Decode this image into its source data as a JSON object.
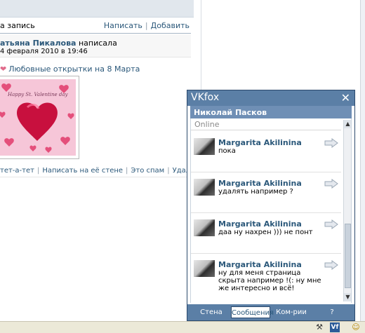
{
  "wall": {
    "label": "а запись",
    "actions": [
      "Написать",
      "Добавить"
    ],
    "author": "атьяна Пикалова",
    "verb": " написала",
    "date": "4 февраля 2010 в 19:46",
    "gift_title": "Любовные открытки на 8 Марта",
    "card_text": "Happy St. Valentine day",
    "post_actions": [
      "тет-а-тет",
      "Написать на её стене",
      "Это спам",
      "Удалить"
    ]
  },
  "vkfox": {
    "title": "VKfox",
    "close": "✕",
    "user": "Николай Пасков",
    "status": "Online",
    "messages": [
      {
        "name": "Margarita Akilinina",
        "text": "пока"
      },
      {
        "name": "Margarita Akilinina",
        "text": "удалять например ?"
      },
      {
        "name": "Margarita Akilinina",
        "text": "даа ну нахрен ))) не понт"
      },
      {
        "name": "Margarita Akilinina",
        "text": "ну для меня страница скрыта например !(: ну мне же интересно и всё!"
      }
    ],
    "tabs": [
      "Стена",
      "Сообщения",
      "Ком-рии",
      "?"
    ],
    "active_tab": 1
  },
  "tray": {
    "vf_label": "Vf"
  },
  "colors": {
    "vk_blue": "#5b7fa6",
    "link": "#2b587a"
  }
}
